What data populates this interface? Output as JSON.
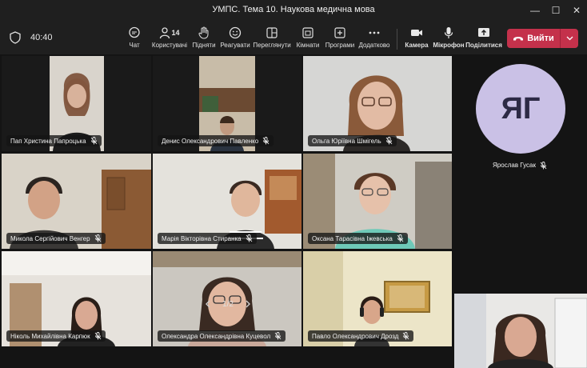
{
  "window": {
    "title": "УМПС. Тема 10. Наукова медична мова"
  },
  "toolbar": {
    "timer": "40:40",
    "chat": "Чат",
    "people": "Користувачі",
    "people_count": "14",
    "raise": "Підняти",
    "react": "Реагувати",
    "view": "Переглянути",
    "rooms": "Кімнати",
    "apps": "Програми",
    "more": "Додатково",
    "camera": "Камера",
    "mic": "Мікрофон",
    "share": "Поділитися",
    "leave": "Вийти"
  },
  "participants": [
    {
      "name": "Пап Христина Папроцька"
    },
    {
      "name": "Денис Олександрович Павленко"
    },
    {
      "name": "Ольга Юріївна Шмігель"
    },
    {
      "name": "Микола Сергійович Венгер"
    },
    {
      "name": "Марія Вікторівна Стиранка"
    },
    {
      "name": "Оксана Тарасівна Іжевська"
    },
    {
      "name": "Ніколь Михайлівна Карпюк"
    },
    {
      "name": "Олександра Олександрівна Куцевол"
    },
    {
      "name": "Павло Олександрович Дрозд"
    }
  ],
  "avatar_participant": {
    "initials": "ЯГ",
    "name": "Ярослав Гусак"
  },
  "pager": {
    "text": "1/2"
  },
  "colors": {
    "leave": "#c4314b",
    "avatar_bg": "#cac1e6",
    "background": "#1f1f1f"
  }
}
